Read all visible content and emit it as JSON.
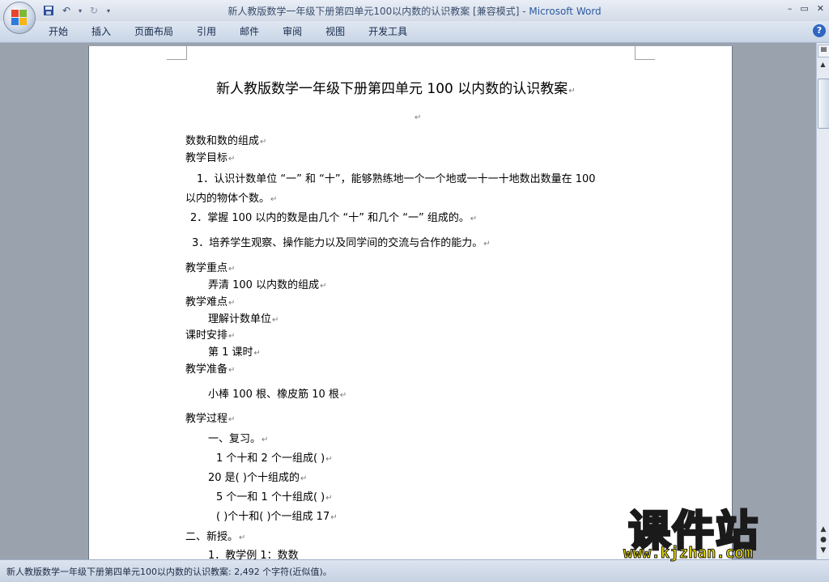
{
  "window": {
    "title": "新人教版数学一年级下册第四单元100以内数的认识教案 [兼容模式]",
    "title_sep": " - ",
    "app_name": "Microsoft Word",
    "controls": {
      "minimize": "–",
      "restore": "▭",
      "close": "✕"
    }
  },
  "qat": {
    "save_icon": "save-icon",
    "undo_icon": "undo-icon",
    "redo_icon": "redo-icon"
  },
  "ribbon": {
    "tabs": [
      "开始",
      "插入",
      "页面布局",
      "引用",
      "邮件",
      "审阅",
      "视图",
      "开发工具"
    ],
    "help": "?"
  },
  "document": {
    "lines": [
      {
        "text": "新人教版数学一年级下册第四单元 100 以内数的认识教案",
        "style": "title"
      },
      {
        "text": "",
        "style": "empty"
      },
      {
        "text": "数数和数的组成",
        "style": "normal"
      },
      {
        "text": "教学目标",
        "style": "normal"
      },
      {
        "text": "1．认识计数单位 “一” 和 “十”，能够熟练地一个一个地或一十一十地数出数量在  100",
        "style": "normal",
        "nomark": true
      },
      {
        "text": "以内的物体个数。",
        "style": "normal"
      },
      {
        "text": "2．掌握 100 以内的数是由几个 “十” 和几个 “一” 组成的。",
        "style": "normal"
      },
      {
        "text": "3．培养学生观察、操作能力以及同学间的交流与合作的能力。",
        "style": "normal"
      },
      {
        "text": "教学重点",
        "style": "normal"
      },
      {
        "text": "弄清 100 以内数的组成",
        "style": "normal"
      },
      {
        "text": "教学难点",
        "style": "normal"
      },
      {
        "text": "理解计数单位",
        "style": "normal"
      },
      {
        "text": "课时安排",
        "style": "normal"
      },
      {
        "text": "第 1 课时",
        "style": "normal"
      },
      {
        "text": "教学准备",
        "style": "normal"
      },
      {
        "text": "小棒 100 根、橡皮筋 10 根",
        "style": "normal"
      },
      {
        "text": "教学过程",
        "style": "normal"
      },
      {
        "text": "一、复习。",
        "style": "normal"
      },
      {
        "text": "1 个十和 2 个一组成(      )",
        "style": "normal"
      },
      {
        "text": "20 是(      )个十组成的",
        "style": "normal"
      },
      {
        "text": "5 个一和 1 个十组成(      )",
        "style": "normal"
      },
      {
        "text": "(      )个十和(      )个一组成 17",
        "style": "normal"
      },
      {
        "text": "二、新授。",
        "style": "normal"
      },
      {
        "text": "1．教学例 1：数数",
        "style": "normal",
        "nomark": true
      }
    ],
    "paragraph_mark": "↵"
  },
  "status": {
    "text": "新人教版数学一年级下册第四单元100以内数的认识教案: 2,492 个字符(近似值)。"
  },
  "watermark": {
    "brand": "课件站",
    "url": "www.kjzhan.com"
  }
}
